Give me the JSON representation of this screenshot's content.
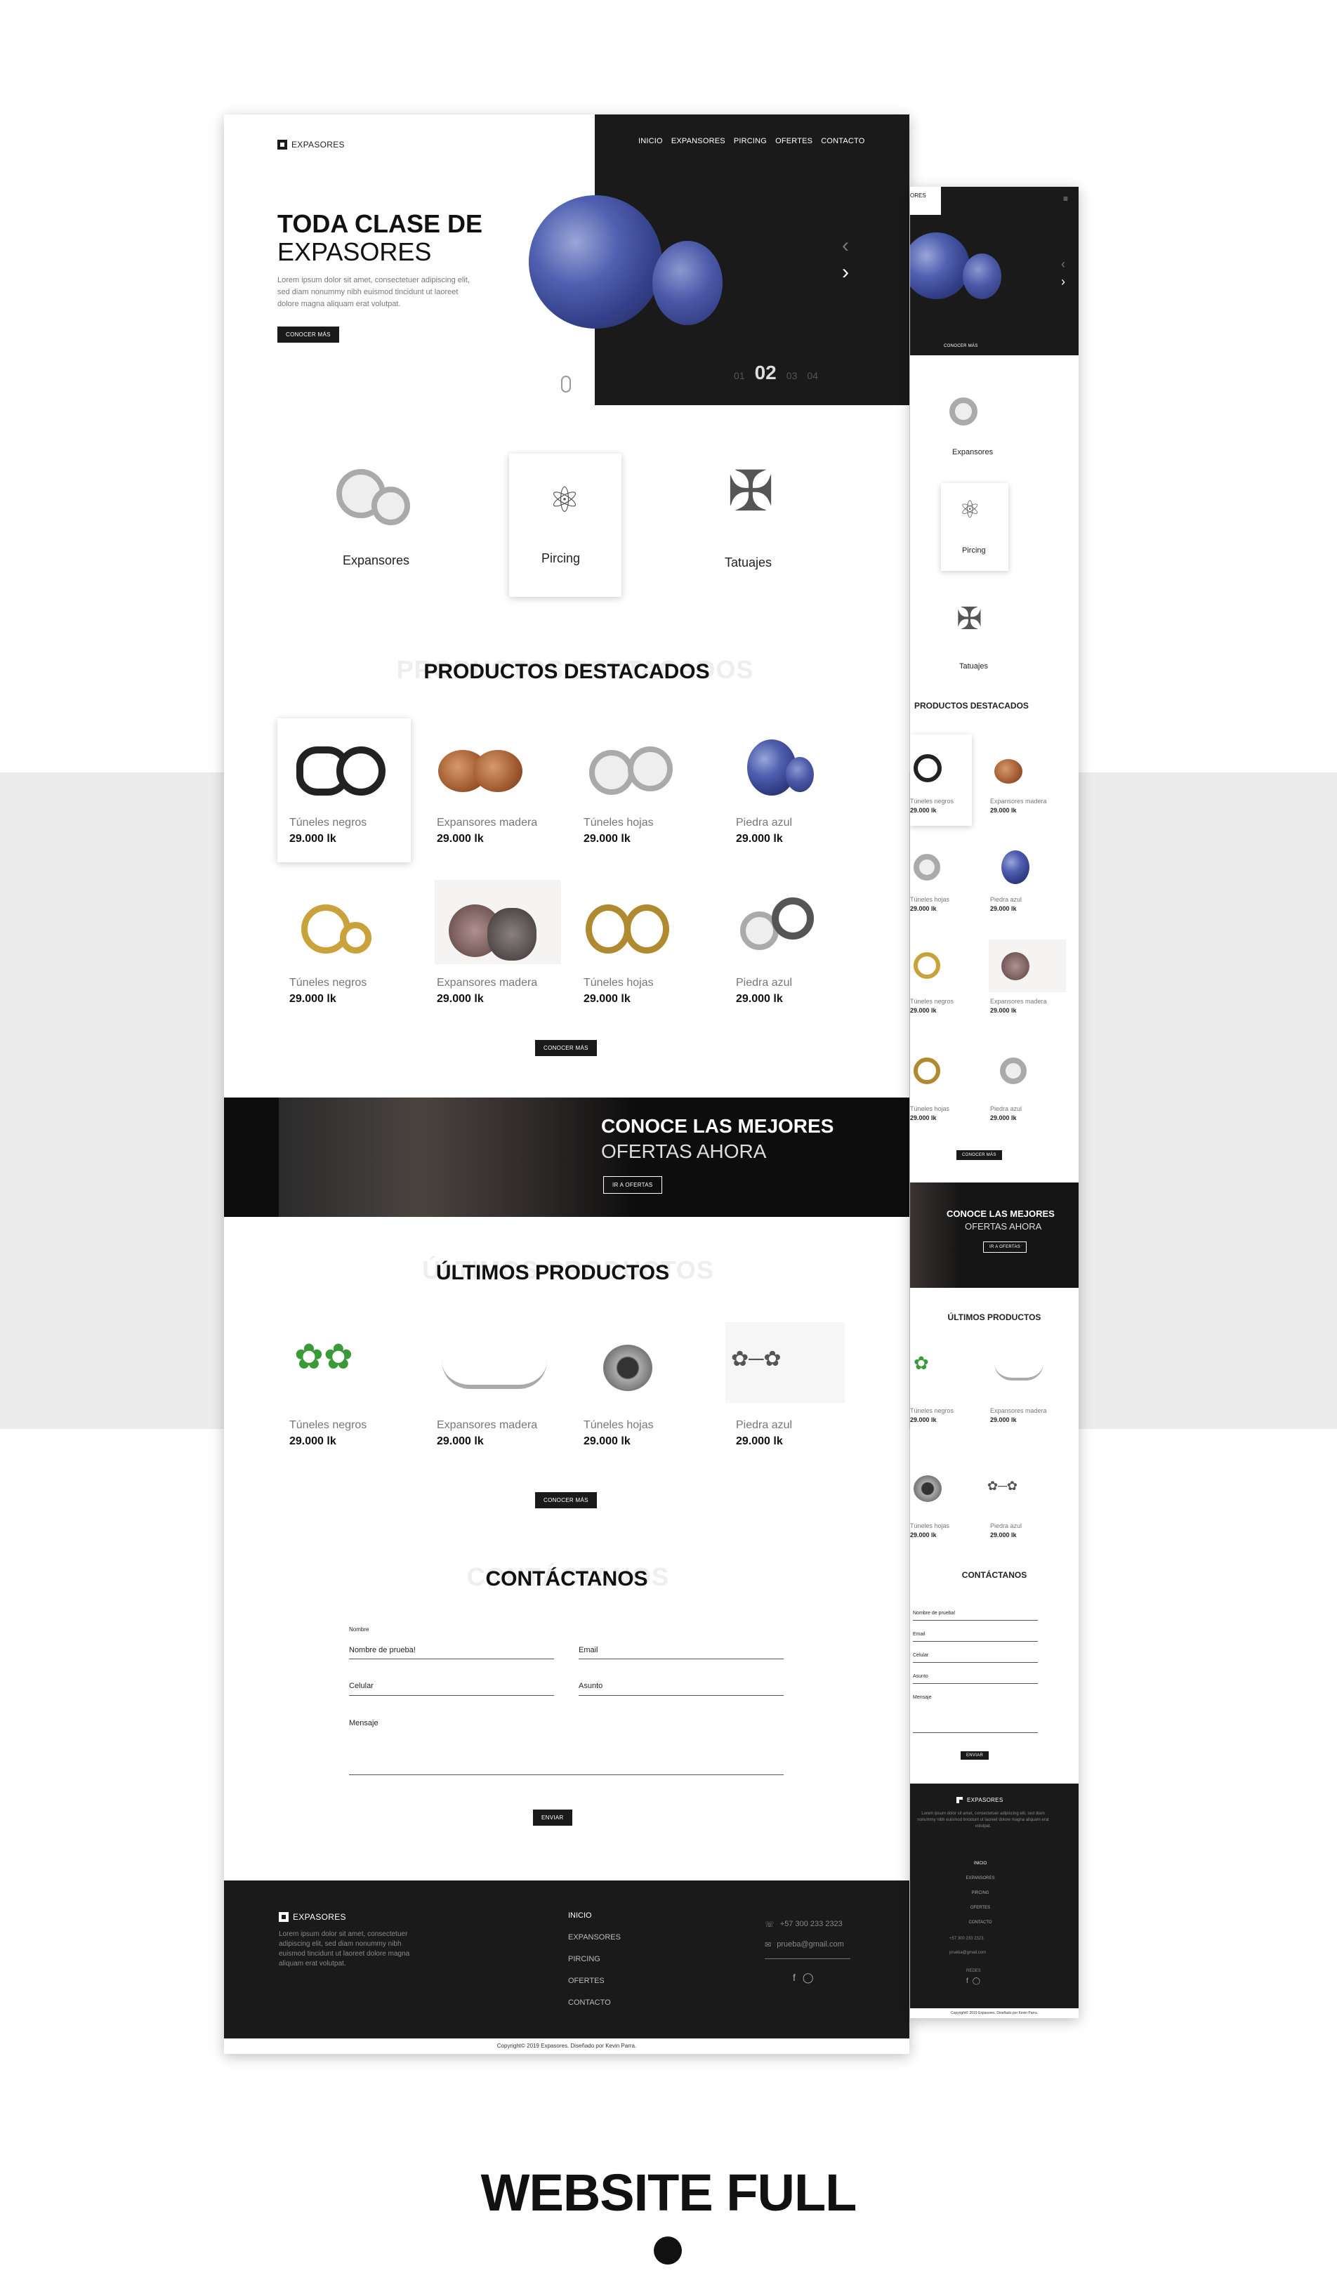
{
  "brand": "EXPASORES",
  "nav": [
    "INICIO",
    "EXPANSORES",
    "PIRCING",
    "OFERTES",
    "CONTACTO"
  ],
  "hero": {
    "title_bold": "TODA CLASE DE",
    "title_light": "EXPASORES",
    "text": "Lorem ipsum dolor sit amet, consectetuer adipiscing elit, sed diam nonummy nibh euismod tincidunt ut laoreet dolore magna aliquam erat volutpat.",
    "button": "CONOCER MÁS",
    "slides": [
      "01",
      "02",
      "03",
      "04"
    ],
    "current": "02",
    "prev_icon": "chevron-left-icon",
    "next_icon": "chevron-right-icon"
  },
  "categories": [
    "Expansores",
    "Pircing",
    "Tatuajes"
  ],
  "featured": {
    "ghost": "PRODUCTOS DESTACADOS",
    "title": "PRODUCTOS DESTACADOS",
    "products": [
      {
        "name": "Túneles negros",
        "price": "29.000 lk"
      },
      {
        "name": "Expansores madera",
        "price": "29.000 lk"
      },
      {
        "name": "Túneles hojas",
        "price": "29.000 lk"
      },
      {
        "name": "Piedra azul",
        "price": "29.000 lk"
      },
      {
        "name": "Túneles negros",
        "price": "29.000 lk"
      },
      {
        "name": "Expansores madera",
        "price": "29.000 lk"
      },
      {
        "name": "Túneles hojas",
        "price": "29.000 lk"
      },
      {
        "name": "Piedra azul",
        "price": "29.000 lk"
      }
    ],
    "button": "CONOCER MÁS"
  },
  "offers": {
    "bold": "CONOCE LAS MEJORES",
    "light": "OFERTAS AHORA",
    "button": "IR A OFERTAS"
  },
  "latest": {
    "ghost": "ÚLTIMOS PRODUCTOS",
    "title": "ÚLTIMOS PRODUCTOS",
    "products": [
      {
        "name": "Túneles negros",
        "price": "29.000 lk"
      },
      {
        "name": "Expansores madera",
        "price": "29.000 lk"
      },
      {
        "name": "Túneles hojas",
        "price": "29.000 lk"
      },
      {
        "name": "Piedra azul",
        "price": "29.000 lk"
      }
    ],
    "button": "CONOCER MÁS"
  },
  "contact": {
    "ghost": "CONTÁCTANOS",
    "title": "CONTÁCTANOS",
    "name_label": "Nombre",
    "name_value": "Nombre de prueba!",
    "email": "Email",
    "phone": "Celular",
    "subject": "Asunto",
    "message": "Mensaje",
    "button": "ENVIAR"
  },
  "footer": {
    "text": "Lorem ipsum dolor sit amet, consectetuer adipiscing elit, sed diam nonummy nibh euismod tincidunt ut laoreet dolore magna aliquam erat volutpat.",
    "links": [
      "INICIO",
      "EXPANSORES",
      "PIRCING",
      "OFERTES",
      "CONTACTO"
    ],
    "phone": "+57 300 233 2323",
    "email": "prueba@gmail.com",
    "social": [
      "facebook-icon",
      "instagram-icon"
    ],
    "copyright": "Copyright© 2019 Expasores. Diseñado por Kevin Parra."
  },
  "mobile": {
    "brand_partial": "ORES",
    "hero_button": "CONOCER MÁS",
    "featured_button": "CONOCER MÁS",
    "latest_title": "ÚLTIMOS PRODUCTOS",
    "contact_name_value": "Nombre de prueba!",
    "contact_email": "Email",
    "contact_phone": "Celular",
    "contact_subject": "Asunto",
    "contact_message": "Mensaje",
    "contact_button": "ENVIAR",
    "footer_text": "Lorem ipsum dolor sit amet, consectetuer adipiscing elit, sed diam nonummy nibh euismod tincidunt ut laoreet dolore magna aliquam erat volutpat.",
    "social_label": "REDES",
    "featured_products": [
      {
        "name": "Túneles negros",
        "price": "29.000 lk"
      },
      {
        "name": "Expansores madera",
        "price": "29.000 lk"
      },
      {
        "name": "Túneles hojas",
        "price": "29.000 lk"
      },
      {
        "name": "Piedra azul",
        "price": "29.000 lk"
      },
      {
        "name": "Túneles negros",
        "price": "29.000 lk"
      },
      {
        "name": "Expansores madera",
        "price": "29.000 lk"
      },
      {
        "name": "Túneles hojas",
        "price": "29.000 lk"
      },
      {
        "name": "Piedra azul",
        "price": "29.000 lk"
      }
    ],
    "latest_products": [
      {
        "name": "Túneles negros",
        "price": "29.000 lk"
      },
      {
        "name": "Expansores madera",
        "price": "29.000 lk"
      },
      {
        "name": "Túneles hojas",
        "price": "29.000 lk"
      },
      {
        "name": "Piedra azul",
        "price": "29.000 lk"
      }
    ]
  },
  "showcase": {
    "title": "WEBSITE FULL"
  }
}
